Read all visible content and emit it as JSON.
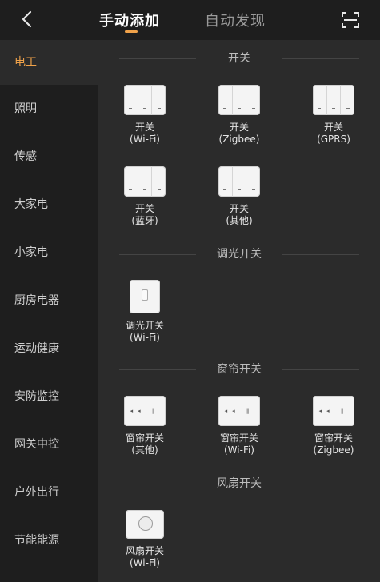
{
  "header": {
    "tab_manual": "手动添加",
    "tab_auto": "自动发现",
    "accent_color": "#f0a24a"
  },
  "sidebar": {
    "items": [
      {
        "label": "电工",
        "active": true
      },
      {
        "label": "照明"
      },
      {
        "label": "传感"
      },
      {
        "label": "大家电"
      },
      {
        "label": "小家电"
      },
      {
        "label": "厨房电器"
      },
      {
        "label": "运动健康"
      },
      {
        "label": "安防监控"
      },
      {
        "label": "网关中控"
      },
      {
        "label": "户外出行"
      },
      {
        "label": "节能能源"
      }
    ]
  },
  "sections": {
    "switch": {
      "title": "开关",
      "devices": [
        {
          "name": "开关",
          "sub": "(Wi-Fi)"
        },
        {
          "name": "开关",
          "sub": "(Zigbee)"
        },
        {
          "name": "开关",
          "sub": "(GPRS)"
        },
        {
          "name": "开关",
          "sub": "(蓝牙)"
        },
        {
          "name": "开关",
          "sub": "(其他)"
        }
      ]
    },
    "dimmer": {
      "title": "调光开关",
      "devices": [
        {
          "name": "调光开关",
          "sub": "(Wi-Fi)"
        }
      ]
    },
    "curtain": {
      "title": "窗帘开关",
      "devices": [
        {
          "name": "窗帘开关",
          "sub": "(其他)"
        },
        {
          "name": "窗帘开关",
          "sub": "(Wi-Fi)"
        },
        {
          "name": "窗帘开关",
          "sub": "(Zigbee)"
        }
      ]
    },
    "fan": {
      "title": "风扇开关",
      "devices": [
        {
          "name": "风扇开关",
          "sub": "(Wi-Fi)"
        }
      ]
    }
  }
}
